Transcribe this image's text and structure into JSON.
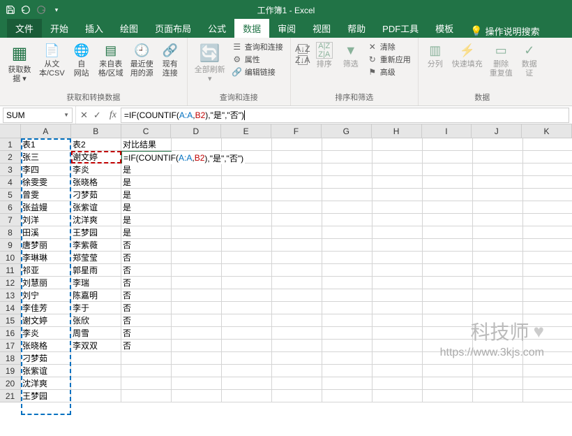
{
  "title": "工作簿1 - Excel",
  "tabs": {
    "file": "文件",
    "home": "开始",
    "insert": "插入",
    "draw": "绘图",
    "pagelayout": "页面布局",
    "formulas": "公式",
    "data": "数据",
    "review": "审阅",
    "view": "视图",
    "help": "帮助",
    "pdf": "PDF工具",
    "template": "模板",
    "tellme": "操作说明搜索"
  },
  "ribbon": {
    "group1": {
      "name": "获取和转换数据",
      "btn1": "获取数\n据 ▾",
      "btn2": "从文\n本/CSV",
      "btn3": "自\n网站",
      "btn4": "来自表\n格/区域",
      "btn5": "最近使\n用的源",
      "btn6": "现有\n连接"
    },
    "group2": {
      "name": "查询和连接",
      "btn1": "全部刷新\n▾",
      "s1": "查询和连接",
      "s2": "属性",
      "s3": "编辑链接"
    },
    "group3": {
      "name": "排序和筛选",
      "btn1": "排序",
      "btn2": "筛选",
      "s1": "清除",
      "s2": "重新应用",
      "s3": "高级"
    },
    "group4": {
      "name": "数据",
      "btn1": "分列",
      "btn2": "快速填充",
      "btn3": "删除\n重复值",
      "btn4": "数据\n证"
    }
  },
  "formula_bar": {
    "namebox": "SUM",
    "formula_prefix": "=IF(COUNTIF(",
    "formula_ref1": "A:A",
    "formula_comma1": ",",
    "formula_ref2": "B2",
    "formula_suffix": "),\"是\",\"否\")"
  },
  "columns": [
    "A",
    "B",
    "C",
    "D",
    "E",
    "F",
    "G",
    "H",
    "I",
    "J",
    "K"
  ],
  "sheet": {
    "headers": {
      "a": "表1",
      "b": "表2",
      "c": "对比结果"
    },
    "rows": [
      {
        "a": "张三",
        "b": "谢文婷",
        "c": "=IF(COUNTIF(A:A,B2),\"是\",\"否\")"
      },
      {
        "a": "李四",
        "b": "李炎",
        "c": "是"
      },
      {
        "a": "徐雯雯",
        "b": "张晓格",
        "c": "是"
      },
      {
        "a": "曾雯",
        "b": "刁梦茹",
        "c": "是"
      },
      {
        "a": "张益嫚",
        "b": "张紫谊",
        "c": "是"
      },
      {
        "a": "刘洋",
        "b": "沈洋爽",
        "c": "是"
      },
      {
        "a": "田溪",
        "b": "王梦园",
        "c": "是"
      },
      {
        "a": "唐梦丽",
        "b": "李紫薇",
        "c": "否"
      },
      {
        "a": "李琳琳",
        "b": "郑莹莹",
        "c": "否"
      },
      {
        "a": "祁亚",
        "b": "郭星雨",
        "c": "否"
      },
      {
        "a": "刘慧丽",
        "b": "李瑞",
        "c": "否"
      },
      {
        "a": "刘宁",
        "b": "陈嘉明",
        "c": "否"
      },
      {
        "a": "李佳芳",
        "b": "李于",
        "c": "否"
      },
      {
        "a": "谢文婷",
        "b": "张欣",
        "c": "否"
      },
      {
        "a": "李炎",
        "b": "周雪",
        "c": "否"
      },
      {
        "a": "张晓格",
        "b": "李双双",
        "c": "否"
      },
      {
        "a": "刁梦茹",
        "b": "",
        "c": ""
      },
      {
        "a": "张紫谊",
        "b": "",
        "c": ""
      },
      {
        "a": "沈洋爽",
        "b": "",
        "c": ""
      },
      {
        "a": "王梦园",
        "b": "",
        "c": ""
      }
    ]
  },
  "watermark": {
    "line1": "科技师",
    "line2": "https://www.3kjs.com"
  }
}
